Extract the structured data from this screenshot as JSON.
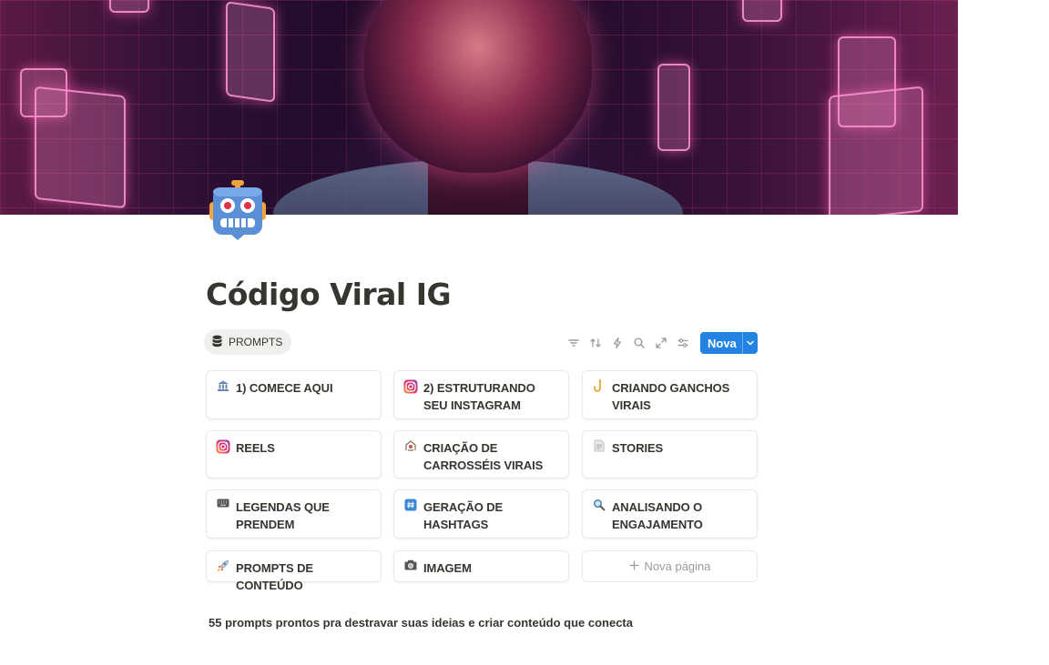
{
  "page": {
    "title": "Código Viral IG",
    "caption": "55 prompts prontos pra destravar suas ideias e criar conteúdo que conecta",
    "page_icon": "robot-icon"
  },
  "database": {
    "tab_label": "PROMPTS",
    "tab_icon": "database-icon",
    "toolbar": {
      "icons": [
        "filter-icon",
        "sort-icon",
        "automation-icon",
        "search-icon",
        "expand-icon",
        "settings-icon"
      ],
      "new_button_label": "Nova"
    },
    "cards": [
      {
        "label": "1) COMECE AQUI",
        "icon": "bank-icon"
      },
      {
        "label": "2) ESTRUTURANDO SEU INSTAGRAM",
        "icon": "instagram-icon"
      },
      {
        "label": "CRIANDO GANCHOS VIRAIS",
        "icon": "hook-icon"
      },
      {
        "label": "REELS",
        "icon": "instagram-icon"
      },
      {
        "label": "CRIAÇÃO DE CARROSSÉIS VIRAIS",
        "icon": "carousel-icon"
      },
      {
        "label": "STORIES",
        "icon": "page-icon"
      },
      {
        "label": "LEGENDAS QUE PRENDEM",
        "icon": "keyboard-icon"
      },
      {
        "label": "GERAÇÃO DE HASHTAGS",
        "icon": "hashtag-icon"
      },
      {
        "label": "ANALISANDO O ENGAJAMENTO",
        "icon": "magnifier-icon"
      },
      {
        "label": "PROMPTS DE CONTEÚDO",
        "icon": "rocket-icon"
      },
      {
        "label": "IMAGEM",
        "icon": "camera-icon"
      }
    ],
    "new_page_label": "Nova página"
  },
  "colors": {
    "accent": "#2383e2",
    "text": "#37352f",
    "muted": "#9b9a97"
  }
}
